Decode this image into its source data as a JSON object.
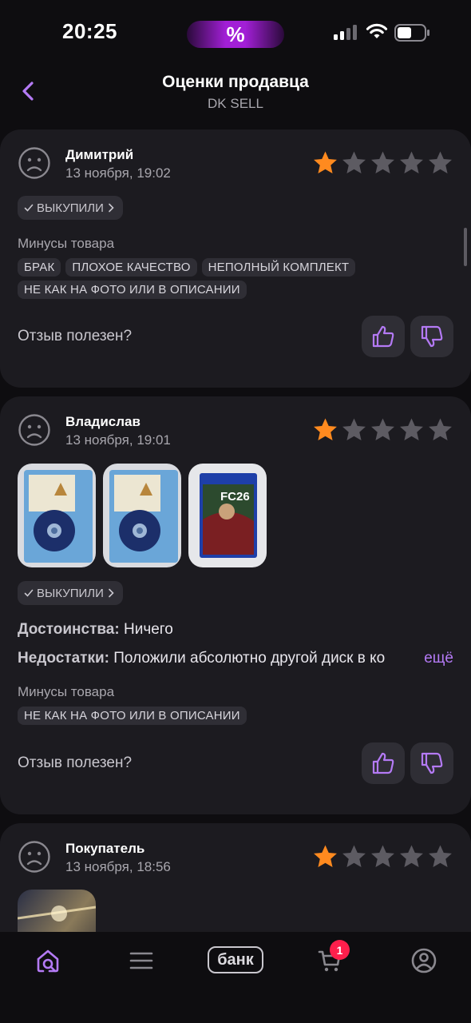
{
  "status_bar": {
    "time": "20:25",
    "promo": "%"
  },
  "header": {
    "title": "Оценки продавца",
    "subtitle": "DK SELL"
  },
  "reviews": [
    {
      "author": "Димитрий",
      "date": "13 ноября, 19:02",
      "rating": 1,
      "purchased_label": "ВЫКУПИЛИ",
      "minuses_label": "Минусы товара",
      "tags": [
        "БРАК",
        "ПЛОХОЕ КАЧЕСТВО",
        "НЕПОЛНЫЙ КОМПЛЕКТ",
        "НЕ КАК НА ФОТО ИЛИ В ОПИСАНИИ"
      ],
      "helpful_label": "Отзыв полезен?"
    },
    {
      "author": "Владислав",
      "date": "13 ноября, 19:01",
      "rating": 1,
      "purchased_label": "ВЫКУПИЛИ",
      "pros_label": "Достоинства:",
      "pros_text": "Ничего",
      "cons_label": "Недостатки:",
      "cons_text": "Положили абсолютно другой диск в ко",
      "more_label": "ещё",
      "minuses_label": "Минусы товара",
      "tags": [
        "НЕ КАК НА ФОТО ИЛИ В ОПИСАНИИ"
      ],
      "photo_caption": "FC26",
      "helpful_label": "Отзыв полезен?"
    },
    {
      "author": "Покупатель",
      "date": "13 ноября, 18:56",
      "rating": 1
    }
  ],
  "bottom_nav": {
    "bank_label": "банк",
    "cart_badge": "1"
  },
  "colors": {
    "accent": "#b47af5",
    "star_active": "#ff8a1f",
    "star_inactive": "#5d5b62",
    "card": "#1c1b20",
    "badge": "#ff1f4c"
  }
}
